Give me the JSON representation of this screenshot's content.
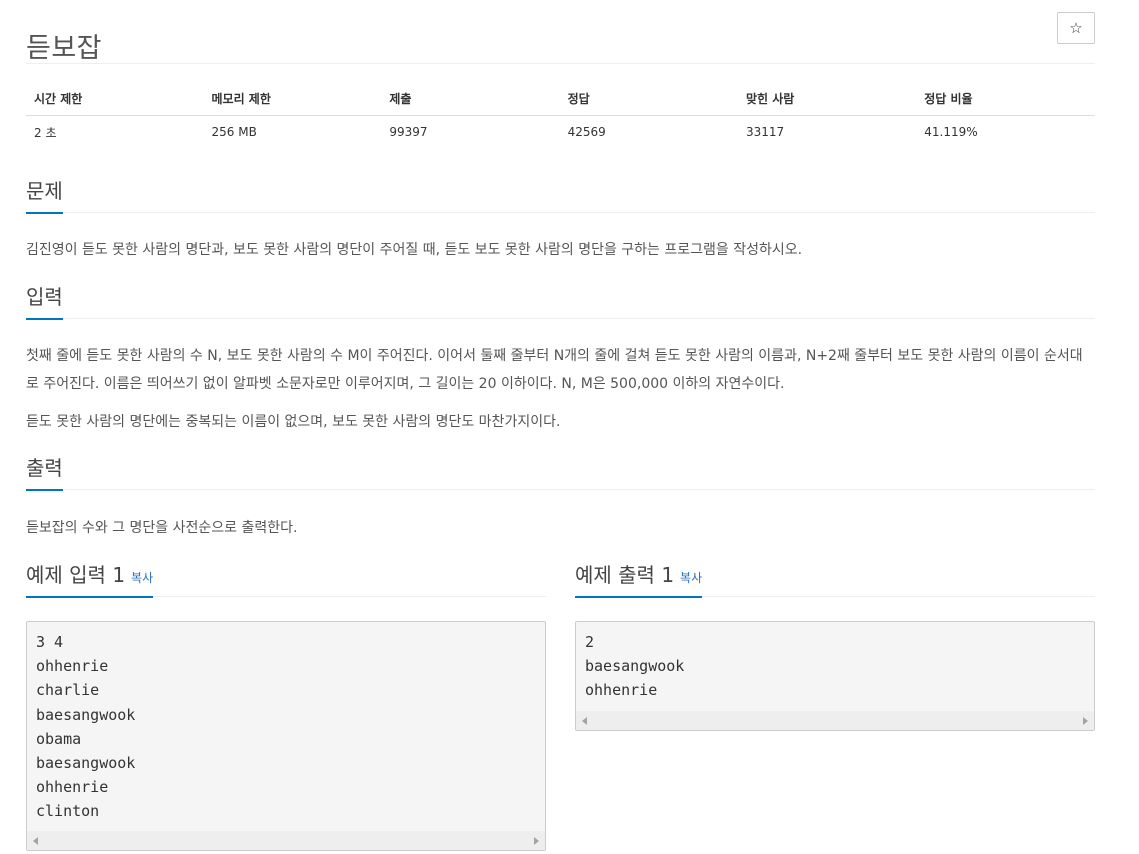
{
  "problem": {
    "title": "듣보잡",
    "star_glyph": "☆"
  },
  "info_table": {
    "headers": [
      "시간 제한",
      "메모리 제한",
      "제출",
      "정답",
      "맞힌 사람",
      "정답 비율"
    ],
    "values": [
      "2 초",
      "256 MB",
      "99397",
      "42569",
      "33117",
      "41.119%"
    ]
  },
  "sections": {
    "description": {
      "heading": "문제",
      "paragraphs": [
        "김진영이 듣도 못한 사람의 명단과, 보도 못한 사람의 명단이 주어질 때, 듣도 보도 못한 사람의 명단을 구하는 프로그램을 작성하시오."
      ]
    },
    "input": {
      "heading": "입력",
      "paragraphs": [
        "첫째 줄에 듣도 못한 사람의 수 N, 보도 못한 사람의 수 M이 주어진다. 이어서 둘째 줄부터 N개의 줄에 걸쳐 듣도 못한 사람의 이름과, N+2째 줄부터 보도 못한 사람의 이름이 순서대로 주어진다. 이름은 띄어쓰기 없이 알파벳 소문자로만 이루어지며, 그 길이는 20 이하이다. N, M은 500,000 이하의 자연수이다.",
        "듣도 못한 사람의 명단에는 중복되는 이름이 없으며, 보도 못한 사람의 명단도 마찬가지이다."
      ]
    },
    "output": {
      "heading": "출력",
      "paragraphs": [
        "듣보잡의 수와 그 명단을 사전순으로 출력한다."
      ]
    }
  },
  "samples": {
    "input": {
      "heading": "예제 입력 1",
      "copy_label": "복사",
      "lines": [
        "3 4",
        "ohhenrie",
        "charlie",
        "baesangwook",
        "obama",
        "baesangwook",
        "ohhenrie",
        "clinton"
      ]
    },
    "output": {
      "heading": "예제 출력 1",
      "copy_label": "복사",
      "lines": [
        "2",
        "baesangwook",
        "ohhenrie"
      ]
    }
  },
  "colors": {
    "accent_underline": "#0076c0",
    "copy_link": "#2a6ebb",
    "code_background": "#f5f5f5"
  }
}
